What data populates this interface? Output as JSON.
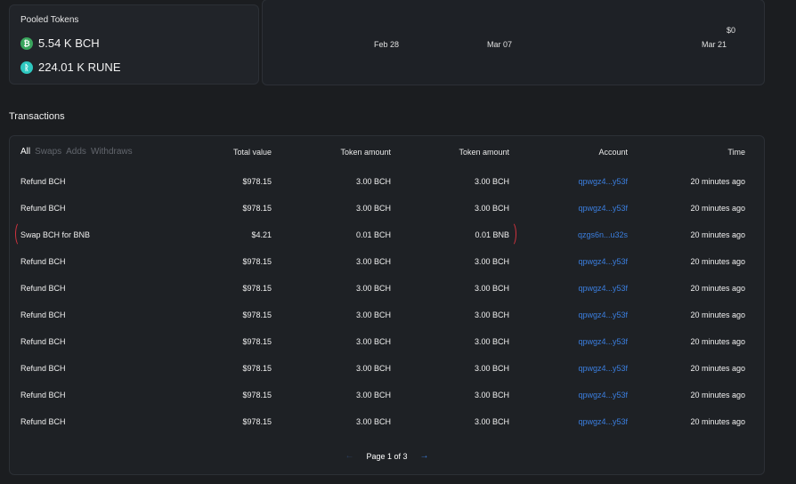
{
  "pooled": {
    "title": "Pooled Tokens",
    "tokens": [
      {
        "amount": "5.54 K BCH",
        "icon": "bch-icon"
      },
      {
        "amount": "224.01 K RUNE",
        "icon": "rune-icon"
      }
    ]
  },
  "chart": {
    "y_label": "$0",
    "x_labels": [
      "Feb 28",
      "Mar 07",
      "Mar 21"
    ]
  },
  "transactions": {
    "title": "Transactions",
    "filters": [
      "All",
      "Swaps",
      "Adds",
      "Withdraws"
    ],
    "active_filter": "All",
    "columns": [
      "Total value",
      "Token amount",
      "Token amount",
      "Account",
      "Time"
    ],
    "rows": [
      {
        "desc": "Refund BCH",
        "value": "$978.15",
        "t1": "3.00 BCH",
        "t2": "3.00 BCH",
        "account": "qpwgz4...y53f",
        "time": "20 minutes ago"
      },
      {
        "desc": "Refund BCH",
        "value": "$978.15",
        "t1": "3.00 BCH",
        "t2": "3.00 BCH",
        "account": "qpwgz4...y53f",
        "time": "20 minutes ago"
      },
      {
        "desc": "Swap BCH for BNB",
        "value": "$4.21",
        "t1": "0.01 BCH",
        "t2": "0.01 BNB",
        "account": "qzgs6n...u32s",
        "time": "20 minutes ago"
      },
      {
        "desc": "Refund BCH",
        "value": "$978.15",
        "t1": "3.00 BCH",
        "t2": "3.00 BCH",
        "account": "qpwgz4...y53f",
        "time": "20 minutes ago"
      },
      {
        "desc": "Refund BCH",
        "value": "$978.15",
        "t1": "3.00 BCH",
        "t2": "3.00 BCH",
        "account": "qpwgz4...y53f",
        "time": "20 minutes ago"
      },
      {
        "desc": "Refund BCH",
        "value": "$978.15",
        "t1": "3.00 BCH",
        "t2": "3.00 BCH",
        "account": "qpwgz4...y53f",
        "time": "20 minutes ago"
      },
      {
        "desc": "Refund BCH",
        "value": "$978.15",
        "t1": "3.00 BCH",
        "t2": "3.00 BCH",
        "account": "qpwgz4...y53f",
        "time": "20 minutes ago"
      },
      {
        "desc": "Refund BCH",
        "value": "$978.15",
        "t1": "3.00 BCH",
        "t2": "3.00 BCH",
        "account": "qpwgz4...y53f",
        "time": "20 minutes ago"
      },
      {
        "desc": "Refund BCH",
        "value": "$978.15",
        "t1": "3.00 BCH",
        "t2": "3.00 BCH",
        "account": "qpwgz4...y53f",
        "time": "20 minutes ago"
      },
      {
        "desc": "Refund BCH",
        "value": "$978.15",
        "t1": "3.00 BCH",
        "t2": "3.00 BCH",
        "account": "qpwgz4...y53f",
        "time": "20 minutes ago"
      }
    ],
    "pagination": {
      "label": "Page 1 of 3",
      "prev": "←",
      "next": "→"
    }
  }
}
